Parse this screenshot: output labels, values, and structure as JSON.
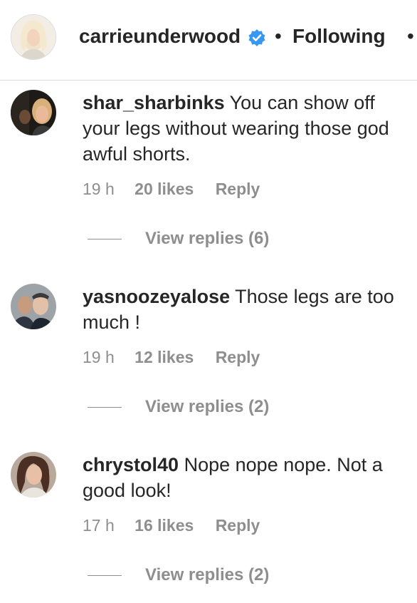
{
  "header": {
    "username": "carrieunderwood",
    "separator": "•",
    "follow_label": "Following",
    "more_label": "•",
    "verified_color": "#3897f0"
  },
  "comments": [
    {
      "username": "shar_sharbinks",
      "text": "You can show off your legs without wearing those god awful shorts.",
      "time": "19 h",
      "likes": "20 likes",
      "reply_label": "Reply",
      "view_replies": "View replies (6)"
    },
    {
      "username": "yasnoozeyalose",
      "text": "Those legs are too much !",
      "time": "19 h",
      "likes": "12 likes",
      "reply_label": "Reply",
      "view_replies": "View replies (2)"
    },
    {
      "username": "chrystol40",
      "text": "Nope nope nope. Not a good look!",
      "time": "17 h",
      "likes": "16 likes",
      "reply_label": "Reply",
      "view_replies": "View replies (2)"
    }
  ]
}
